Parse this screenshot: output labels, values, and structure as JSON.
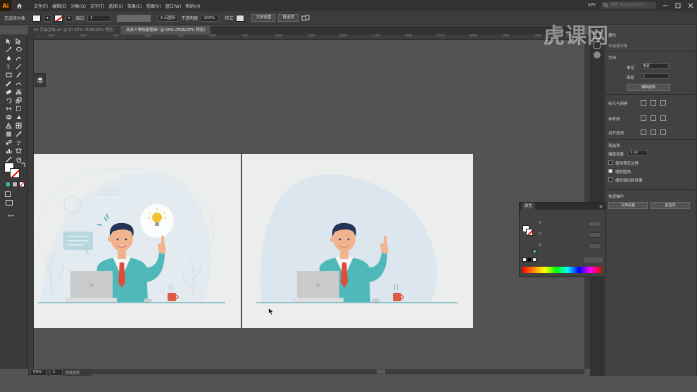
{
  "app": {
    "logo": "Ai",
    "workspace": "XPY",
    "search_placeholder": "搜索 Adobe Stock"
  },
  "menu": [
    "文件(F)",
    "编辑(E)",
    "对象(O)",
    "文字(T)",
    "选择(S)",
    "效果(C)",
    "视图(V)",
    "窗口(W)",
    "帮助(H)"
  ],
  "control": {
    "no_selection": "无选择对象",
    "stroke_label": "描边",
    "points": "3 点圆形",
    "opacity_label": "不透明度",
    "opacity": "100%",
    "style_label": "样式",
    "doc_setup": "文档设置",
    "prefs": "首选项"
  },
  "tabs": [
    {
      "label": "04 实操立绘.ai* @ 67.67% (RGB/GPU 预览)",
      "active": false
    },
    {
      "label": "商务人物场景插画* @ 50% (RGB/GPU 预览)",
      "active": true
    }
  ],
  "ruler_marks": [
    "300",
    "400",
    "500",
    "600",
    "700",
    "800",
    "900",
    "1000",
    "1100",
    "1200",
    "1300",
    "1400",
    "1500",
    "1600",
    "1700",
    "1800",
    "1900"
  ],
  "status": {
    "zoom": "50%",
    "page": "1",
    "tool": "直接选择"
  },
  "properties": {
    "tab": "属性",
    "section_none": "未选择对象",
    "doc_title": "文档",
    "unit_label": "单位",
    "unit": "像素",
    "artboard_label": "画板",
    "artboard_value": "1",
    "edit_artboards": "编辑画板",
    "rulers_grid": "标尺与网格",
    "guides": "参考线",
    "snap": "对齐选项",
    "prefs_title": "首选项",
    "keyboard_inc_label": "键盘增量",
    "keyboard_inc": "1 px",
    "preview_bounds": "使用预览边界",
    "scale_corners": "缩放圆角",
    "scale_strokes": "缩放描边和效果",
    "quick_actions": "快速操作",
    "doc_setup_btn": "文档设置",
    "prefs_btn": "首选项"
  },
  "color_panel": {
    "title": "颜色",
    "channels": [
      "R",
      "G",
      "B"
    ]
  },
  "watermark": "虎课网",
  "colors": {
    "suit": "#4fb8b8",
    "tie": "#e04b3a",
    "hair": "#233457",
    "blob": "#dbe6ef",
    "laptop": "#c9cbcd",
    "mug": "#e05a48",
    "bulb": "#f4c430",
    "floor": "#5aa9b0"
  }
}
